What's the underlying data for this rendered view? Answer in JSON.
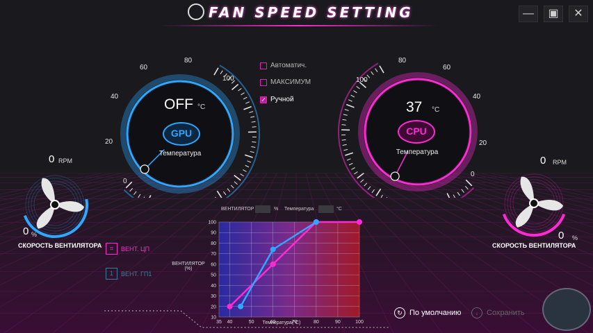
{
  "window": {
    "title": "FAN SPEED SETTING",
    "minimize": "—",
    "maximize": "▣",
    "close": "✕"
  },
  "gpu": {
    "ticks": [
      "0",
      "20",
      "40",
      "60",
      "80",
      "100"
    ],
    "temperature_value": "OFF",
    "unit": "°C",
    "chip_label": "GPU",
    "caption": "Температура",
    "needle_value": 0
  },
  "cpu": {
    "ticks": [
      "0",
      "20",
      "40",
      "60",
      "80",
      "100"
    ],
    "temperature_value": "37",
    "unit": "°C",
    "chip_label": "CPU",
    "caption": "Температура",
    "needle_value": 37
  },
  "modes": [
    {
      "label": "Автоматич.",
      "checked": false,
      "mark": ""
    },
    {
      "label": "МАКСИМУМ",
      "checked": false,
      "mark": ""
    },
    {
      "label": "Ручной",
      "checked": true,
      "mark": "✓"
    }
  ],
  "left_fan": {
    "rpm_value": "0",
    "rpm_unit": "RPM",
    "percent_value": "0",
    "percent_unit": "%",
    "label": "СКОРОСТЬ ВЕНТИЛЯТОРА"
  },
  "right_fan": {
    "rpm_value": "0",
    "rpm_unit": "RPM",
    "percent_value": "0",
    "percent_unit": "%",
    "label": "СКОРОСТЬ ВЕНТИЛЯТОРА"
  },
  "fan_selectors": [
    {
      "icon": "⌗",
      "label": "ВЕНТ. ЦП",
      "active": true
    },
    {
      "icon": "1",
      "label": "ВЕНТ. ГП1",
      "active": false
    }
  ],
  "chart_header": {
    "fan_label": "ВЕНТИЛЯТОР",
    "fan_unit": "%",
    "temp_label": "Температура",
    "temp_unit": "°C"
  },
  "chart_data": {
    "type": "line",
    "ylabel": "ВЕНТИЛЯТОР (%)",
    "ylabel_line1": "ВЕНТИЛЯТОР",
    "ylabel_line2": "(%)",
    "xlabel": "Температура(°C)",
    "x_ticks": [
      35,
      40,
      50,
      60,
      70,
      80,
      90,
      100
    ],
    "y_ticks": [
      10,
      20,
      30,
      40,
      50,
      60,
      70,
      80,
      90,
      100
    ],
    "xlim": [
      35,
      100
    ],
    "ylim": [
      10,
      100
    ],
    "grid": true,
    "series": [
      {
        "color": "#ff2ad4",
        "points": [
          [
            40,
            20
          ],
          [
            60,
            60
          ],
          [
            80,
            100
          ],
          [
            100,
            100
          ]
        ]
      },
      {
        "color": "#2fa6ff",
        "points": [
          [
            45,
            20
          ],
          [
            60,
            74
          ],
          [
            80,
            100
          ]
        ]
      }
    ]
  },
  "buttons": {
    "default_label": "По умолчанию",
    "default_icon": "↻",
    "save_label": "Сохранить",
    "save_icon": "↓"
  },
  "colors": {
    "accent_pink": "#ff2ad4",
    "accent_blue": "#2fa6ff",
    "background": "#1a1a1e"
  }
}
